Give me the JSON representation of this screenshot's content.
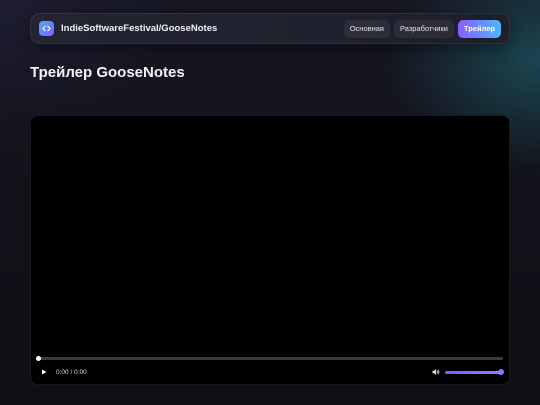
{
  "header": {
    "brand": "IndieSoftwareFestival/GooseNotes",
    "logo_icon": "code-icon",
    "nav": [
      {
        "label": "Основная",
        "active": false
      },
      {
        "label": "Разработчики",
        "active": false
      },
      {
        "label": "Трейлер",
        "active": true
      }
    ]
  },
  "main": {
    "title": "Трейлер GooseNotes"
  },
  "player": {
    "time": "0:00 / 0:00",
    "progress_fraction": 0,
    "volume_fraction": 1,
    "play_icon": "play-icon",
    "volume_icon": "volume-icon"
  },
  "colors": {
    "accent_start": "#8a5cff",
    "accent_end": "#4fb6ff",
    "volume": "#7a5cff"
  }
}
